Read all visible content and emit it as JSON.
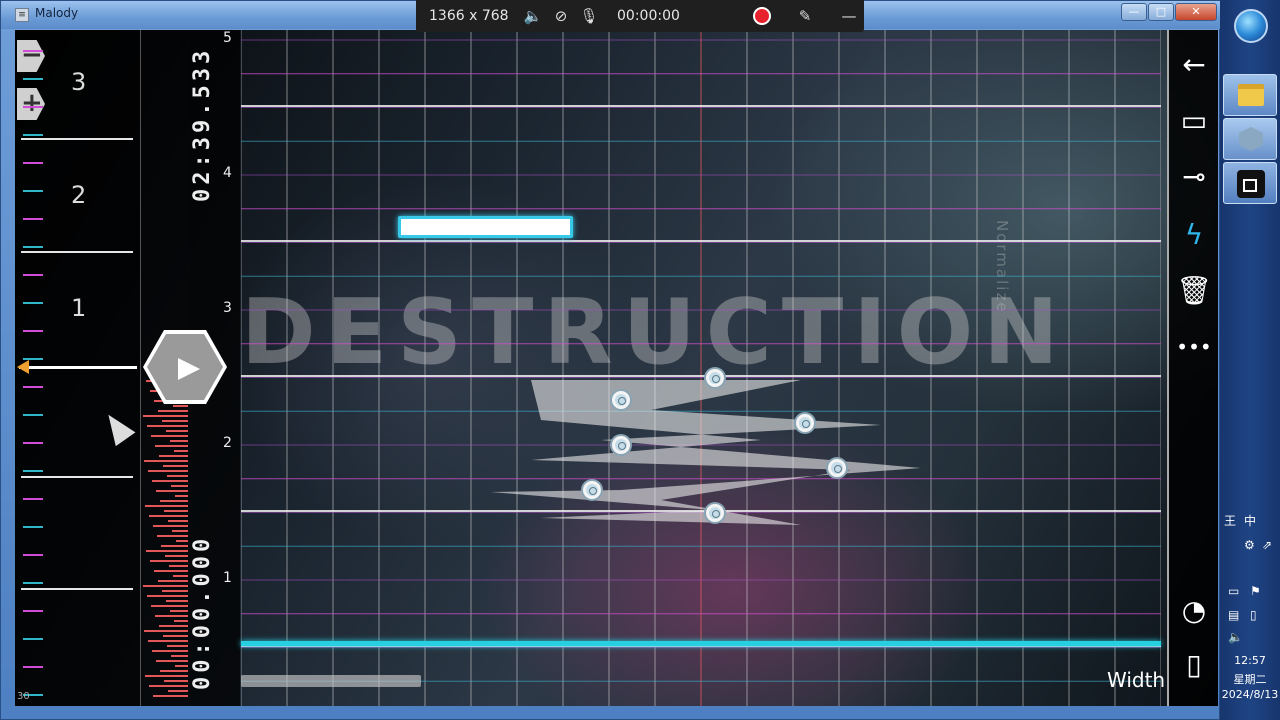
{
  "window": {
    "title": "Malody"
  },
  "recorder": {
    "resolution": "1366 x 768",
    "time": "00:00:00",
    "icons": [
      "speaker-icon",
      "camera-off-icon",
      "mic-off-icon",
      "record-icon",
      "pen-icon",
      "collapse-icon"
    ]
  },
  "editor": {
    "measure_numbers": [
      "3",
      "2",
      "1"
    ],
    "time_top": "02:39.533",
    "time_bottom": "00:00.000",
    "beat_labels": [
      "5",
      "4",
      "3",
      "2",
      "1"
    ],
    "left_bottom_label": "30",
    "background_title": "DESTRUCTION",
    "side_caption": "Normalize",
    "width_label": "Width",
    "colors": {
      "judge_line": "#26d0e0",
      "magenta_tick": "#d24dd6",
      "cyan_tick": "#30b6c9",
      "density": "#e25757"
    }
  },
  "tools": {
    "items": [
      {
        "name": "back-icon",
        "glyph": "←"
      },
      {
        "name": "tap-note-tool-icon",
        "glyph": "▭"
      },
      {
        "name": "hold-note-tool-icon",
        "glyph": "⊸"
      },
      {
        "name": "slide-note-tool-icon",
        "glyph": "ϟ",
        "active": true
      },
      {
        "name": "delete-icon",
        "glyph": "🗑"
      },
      {
        "name": "more-icon",
        "glyph": "•••"
      },
      {
        "name": "speed-gauge-icon",
        "glyph": "◔"
      },
      {
        "name": "ruler-icon",
        "glyph": "▯"
      }
    ]
  },
  "taskbar": {
    "tray": {
      "ime": "中",
      "ime_icon": "王"
    },
    "clock": {
      "time": "12:57",
      "day": "星期二",
      "date": "2024/8/13"
    }
  }
}
